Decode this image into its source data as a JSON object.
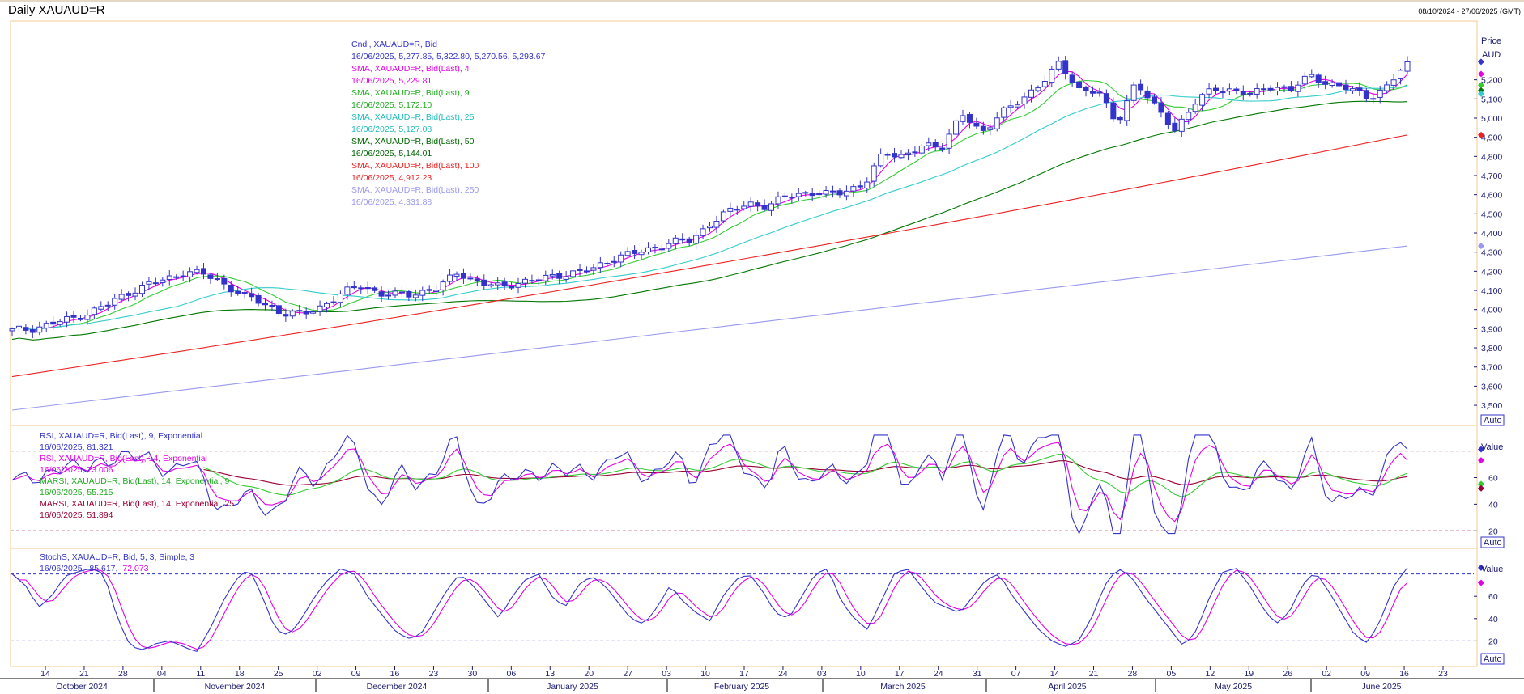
{
  "window": {
    "title": "Daily XAUAUD=R",
    "date_range": "08/10/2024 - 27/06/2025 (GMT)"
  },
  "colors": {
    "candle": "#3333cc",
    "sma4": "#e600e6",
    "sma9": "#33cc33",
    "sma25": "#33cccc",
    "sma50": "#007700",
    "sma100": "#ee2222",
    "sma250": "#9999ee",
    "rsi9": "#3333cc",
    "rsi14": "#e600e6",
    "marsi9": "#33cc33",
    "marsi25": "#990033",
    "stoch_k": "#3333cc",
    "stoch_d": "#e600e6",
    "panel_border": "#f0c890",
    "level_line": "#990033"
  },
  "chart_data": [
    {
      "type": "candlestick",
      "panel": "price",
      "axis_label": "Price",
      "axis_unit": "AUD",
      "auto_button": "Auto",
      "y_ticks": [
        "3,500",
        "3,600",
        "3,700",
        "3,800",
        "3,900",
        "4,000",
        "4,100",
        "4,200",
        "4,300",
        "4,400",
        "4,500",
        "4,600",
        "4,700",
        "4,800",
        "4,900",
        "5,000",
        "5,100",
        "5,200"
      ],
      "ylim": [
        3420,
        5490
      ],
      "x_day_ticks": [
        "14",
        "21",
        "28",
        "04",
        "11",
        "18",
        "25",
        "02",
        "09",
        "16",
        "23",
        "30",
        "06",
        "13",
        "20",
        "27",
        "03",
        "10",
        "17",
        "24",
        "03",
        "10",
        "17",
        "24",
        "31",
        "07",
        "14",
        "21",
        "28",
        "05",
        "12",
        "19",
        "26",
        "02",
        "09",
        "16",
        "23"
      ],
      "x_month_labels": [
        "October 2024",
        "November 2024",
        "December 2024",
        "January 2025",
        "February 2025",
        "March 2025",
        "April 2025",
        "May 2025",
        "June 2025"
      ],
      "legend": [
        {
          "key": "candle",
          "name": "Cndl, XAUAUD=R, Bid",
          "value": "16/06/2025, 5,277.85, 5,322.80, 5,270.56, 5,293.67"
        },
        {
          "key": "sma4",
          "name": "SMA, XAUAUD=R, Bid(Last),  4",
          "value": "16/06/2025, 5,229.81"
        },
        {
          "key": "sma9",
          "name": "SMA, XAUAUD=R, Bid(Last),  9",
          "value": "16/06/2025, 5,172.10"
        },
        {
          "key": "sma25",
          "name": "SMA, XAUAUD=R, Bid(Last),  25",
          "value": "16/06/2025, 5,127.08"
        },
        {
          "key": "sma50",
          "name": "SMA, XAUAUD=R, Bid(Last),  50",
          "value": "16/06/2025, 5,144.01"
        },
        {
          "key": "sma100",
          "name": "SMA, XAUAUD=R, Bid(Last),  100",
          "value": "16/06/2025, 4,912.23"
        },
        {
          "key": "sma250",
          "name": "SMA, XAUAUD=R, Bid(Last),  250",
          "value": "16/06/2025, 4,331.88"
        }
      ],
      "close_anchors": [
        3890,
        3900,
        3925,
        3950,
        3985,
        4030,
        4090,
        4130,
        4160,
        4200,
        4180,
        4130,
        4070,
        4030,
        3980,
        3975,
        4020,
        4080,
        4130,
        4080,
        4075,
        4090,
        4110,
        4200,
        4140,
        4120,
        4140,
        4150,
        4180,
        4190,
        4215,
        4270,
        4290,
        4320,
        4350,
        4360,
        4450,
        4510,
        4560,
        4530,
        4600,
        4610,
        4600,
        4625,
        4650,
        4830,
        4800,
        4850,
        4860,
        5020,
        4920,
        5030,
        5080,
        5180,
        5280,
        5150,
        5150,
        4960,
        5200,
        5050,
        4940,
        5080,
        5150,
        5150,
        5120,
        5170,
        5150,
        5220,
        5180,
        5150,
        5110,
        5165,
        5294
      ]
    },
    {
      "type": "line",
      "panel": "rsi",
      "axis_label": "Value",
      "auto_button": "Auto",
      "y_ticks": [
        "20",
        "40",
        "60"
      ],
      "ylim": [
        8,
        98
      ],
      "levels": [
        80,
        20
      ],
      "legend": [
        {
          "key": "rsi9",
          "name": "RSI, XAUAUD=R, Bid(Last),  9, Exponential",
          "value": "16/06/2025, 81.321"
        },
        {
          "key": "rsi14",
          "name": "RSI, XAUAUD=R, Bid(Last),  14, Exponential",
          "value": "16/06/2025, 73.006"
        },
        {
          "key": "marsi9",
          "name": "MARSI, XAUAUD=R, Bid(Last),  14, Exponential, 9",
          "value": "16/06/2025, 55.215"
        },
        {
          "key": "marsi25",
          "name": "MARSI, XAUAUD=R, Bid(Last),  14, Exponential, 25",
          "value": "16/06/2025, 51.894"
        }
      ]
    },
    {
      "type": "line",
      "panel": "stochastic",
      "axis_label": "Value",
      "auto_button": "Auto",
      "y_ticks": [
        "20",
        "40",
        "60"
      ],
      "ylim": [
        0,
        100
      ],
      "levels": [
        80,
        20
      ],
      "legend_name": "StochS, XAUAUD=R, Bid,  5, 3, Simple, 3",
      "legend_value_date": "16/06/2025,",
      "legend_value_k": "85.617,",
      "legend_value_d": "72.073",
      "k_anchors": [
        80,
        70,
        50,
        60,
        78,
        82,
        85,
        80,
        40,
        15,
        12,
        18,
        20,
        15,
        10,
        30,
        55,
        75,
        85,
        60,
        30,
        25,
        40,
        60,
        75,
        85,
        80,
        60,
        45,
        30,
        22,
        25,
        45,
        65,
        80,
        70,
        55,
        40,
        60,
        75,
        80,
        60,
        50,
        70,
        78,
        70,
        55,
        40,
        35,
        50,
        70,
        55,
        45,
        38,
        60,
        75,
        80,
        65,
        45,
        40,
        60,
        80,
        85,
        55,
        40,
        30,
        55,
        80,
        85,
        70,
        55,
        50,
        45,
        60,
        75,
        80,
        60,
        45,
        30,
        20,
        15,
        20,
        40,
        70,
        85,
        78,
        60,
        45,
        30,
        15,
        30,
        60,
        82,
        85,
        70,
        50,
        35,
        45,
        70,
        82,
        65,
        45,
        25,
        18,
        40,
        70,
        86
      ]
    }
  ]
}
